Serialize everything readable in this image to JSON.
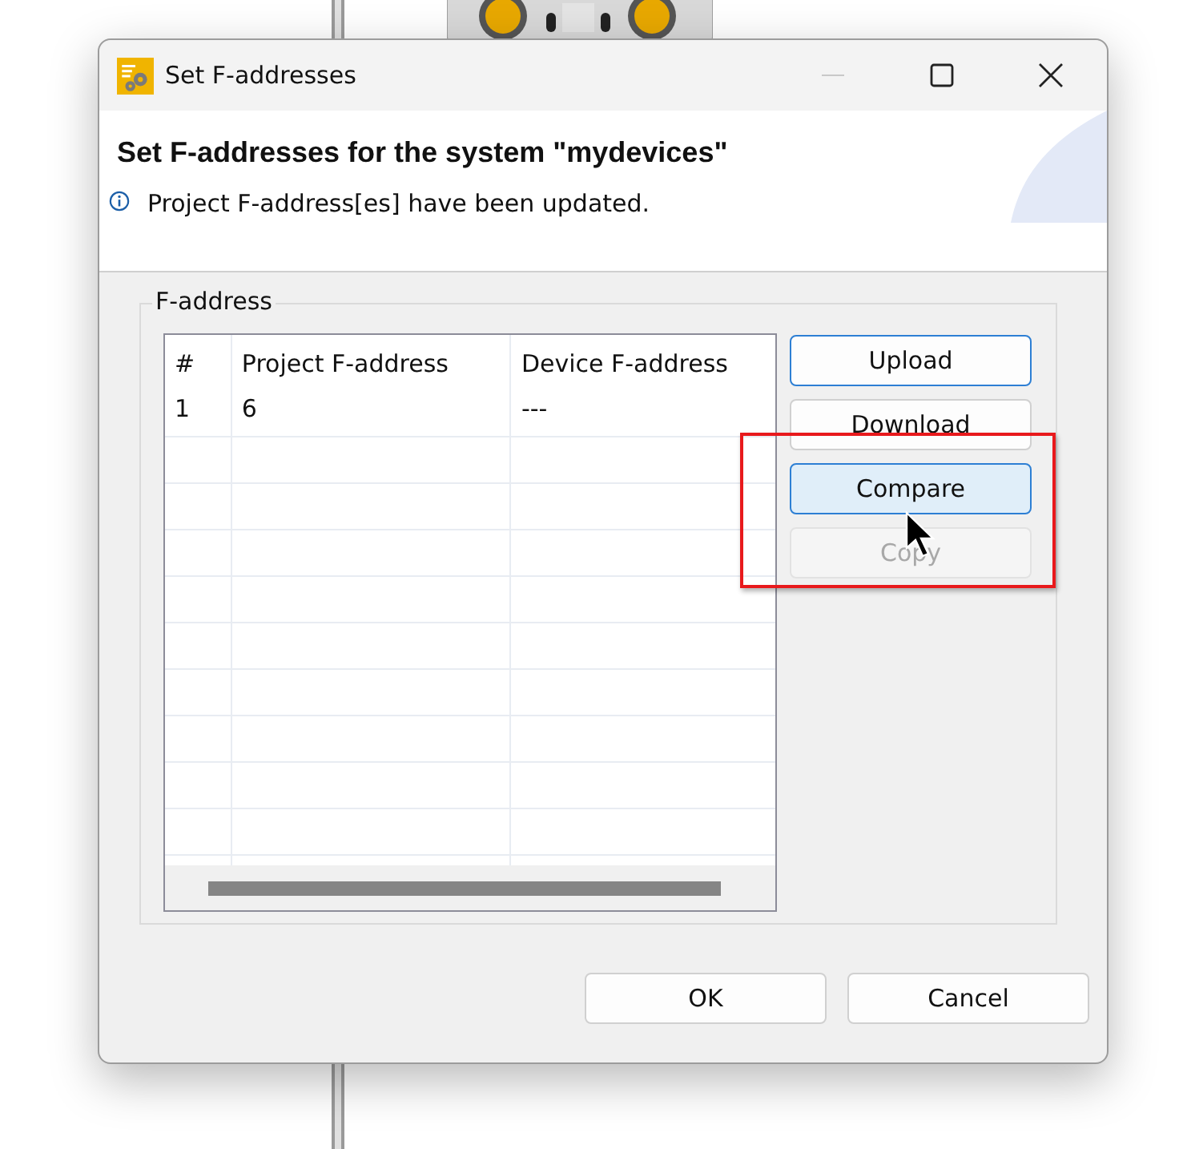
{
  "window": {
    "title": "Set F-addresses"
  },
  "header": {
    "title": "Set F-addresses for the system \"mydevices\"",
    "message": "Project F-address[es] have been updated."
  },
  "group": {
    "legend": "F-address",
    "table": {
      "columns": [
        "#",
        "Project F-address",
        "Device F-address"
      ],
      "rows": [
        [
          "1",
          "6",
          "---"
        ]
      ]
    },
    "buttons": [
      {
        "label": "Upload",
        "default": true,
        "hovered": false,
        "disabled": false
      },
      {
        "label": "Download",
        "default": false,
        "hovered": false,
        "disabled": false
      },
      {
        "label": "Compare",
        "default": false,
        "hovered": true,
        "disabled": false
      },
      {
        "label": "Copy",
        "default": false,
        "hovered": false,
        "disabled": true
      }
    ]
  },
  "footer_buttons": [
    "OK",
    "Cancel"
  ]
}
